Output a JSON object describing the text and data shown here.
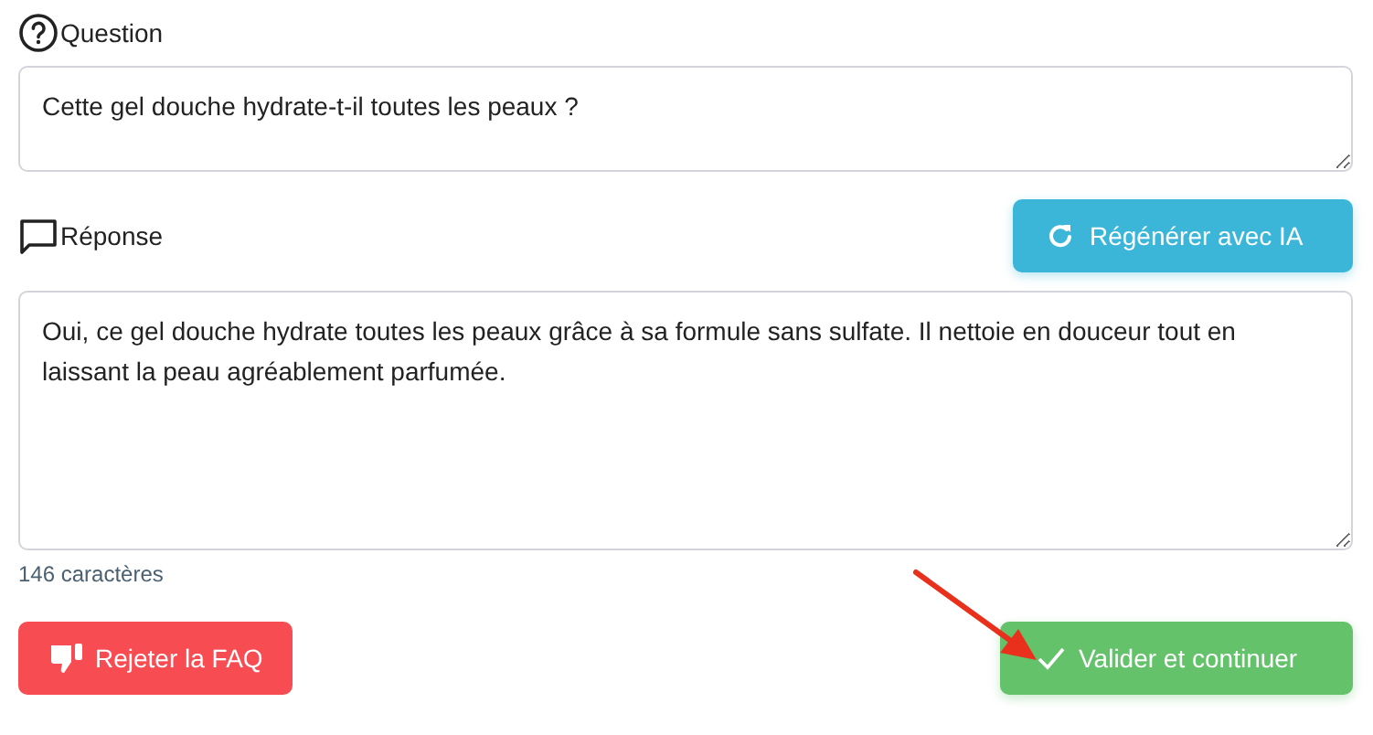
{
  "question": {
    "label": "Question",
    "value": "Cette gel douche hydrate-t-il toutes les peaux ?"
  },
  "answer": {
    "label": "Réponse",
    "value": "Oui, ce gel douche hydrate toutes les peaux grâce à sa formule sans sulfate. Il nettoie en douceur tout en laissant la peau agréablement parfumée.",
    "char_count": "146 caractères"
  },
  "regenerate_button": {
    "label": "Régénérer avec IA"
  },
  "reject_button": {
    "label": "Rejeter la FAQ"
  },
  "validate_button": {
    "label": "Valider et continuer"
  }
}
